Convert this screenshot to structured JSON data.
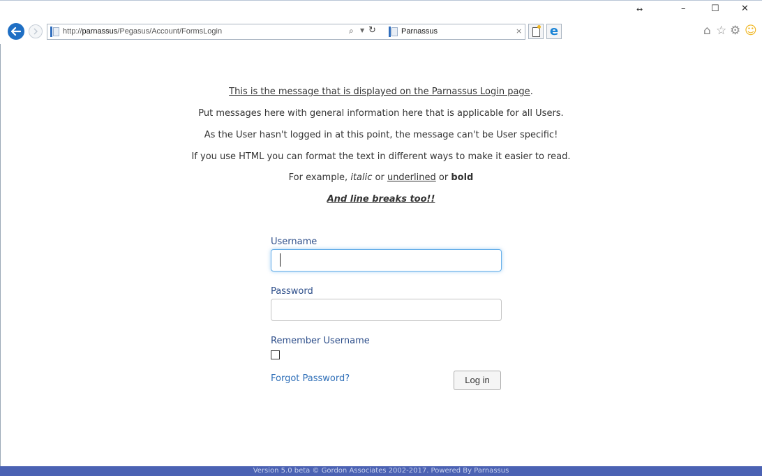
{
  "browser": {
    "url_prefix": "http://",
    "url_host": "parnassus",
    "url_path": "/Pegasus/Account/FormsLogin",
    "tab_title": "Parnassus",
    "tab_close": "×",
    "window_buttons": {
      "restore_arrows": "↔",
      "minimize": "–",
      "maximize": "☐",
      "close": "✕"
    },
    "icons": [
      "back-arrow-icon",
      "forward-icon",
      "page-icon",
      "search-icon",
      "dropdown-icon",
      "refresh-icon",
      "new-tab-icon",
      "ie-logo-icon",
      "home-icon",
      "favorites-star-icon",
      "settings-gear-icon",
      "smiley-feedback-icon"
    ]
  },
  "message": {
    "line1": "This is the message that is displayed on the Parnassus Login page",
    "line1_end": ".",
    "line2": "Put messages here with general information here that is applicable for all Users.",
    "line3": "As the User hasn't logged in at this point, the message can't be User specific!",
    "line4": "If you use HTML you can format the text in different ways to make it easier to read.",
    "line5_prefix": "For example, ",
    "line5_italic": "italic",
    "line5_or1": " or ",
    "line5_underlined": "underlined",
    "line5_or2": " or ",
    "line5_bold": "bold",
    "line6": "And line breaks too!!"
  },
  "form": {
    "username_label": "Username",
    "username_value": "",
    "password_label": "Password",
    "password_value": "",
    "remember_label": "Remember Username",
    "remember_checked": false,
    "forgot_link": "Forgot Password?",
    "login_button": "Log in"
  },
  "footer": {
    "text": "Version 5.0 beta © Gordon Associates 2002-2017. Powered By Parnassus"
  },
  "colors": {
    "accent_blue": "#2f6fb8",
    "label_blue": "#2d4e8a",
    "footer_bar": "#4b62b3",
    "focus_ring": "#66afe9"
  }
}
